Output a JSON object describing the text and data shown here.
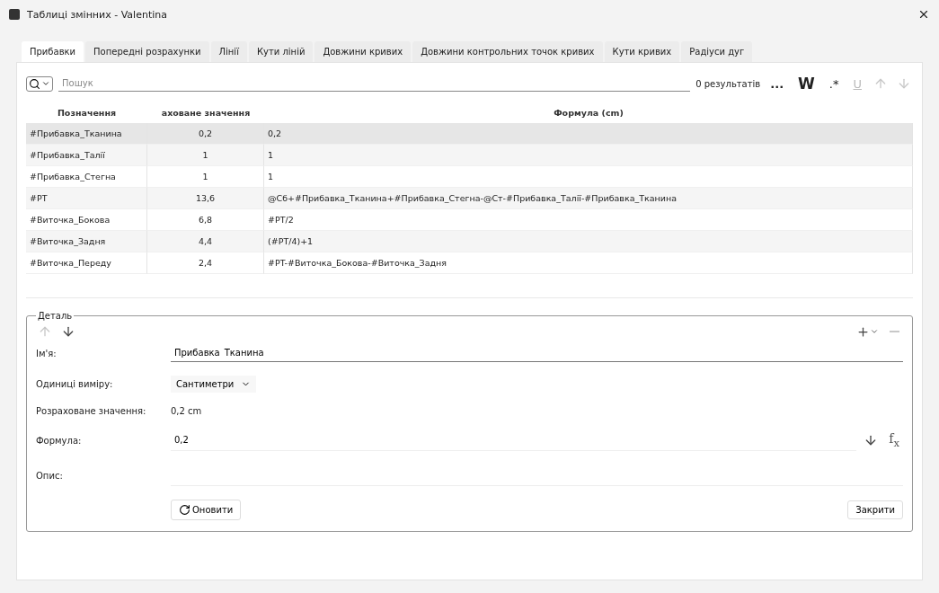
{
  "window": {
    "title": "Таблиці змінних - Valentina"
  },
  "tabs": [
    {
      "label": "Прибавки",
      "selected": true
    },
    {
      "label": "Попередні розрахунки",
      "selected": false
    },
    {
      "label": "Лінії",
      "selected": false
    },
    {
      "label": "Кути ліній",
      "selected": false
    },
    {
      "label": "Довжини кривих",
      "selected": false
    },
    {
      "label": "Довжини контрольних точок кривих",
      "selected": false
    },
    {
      "label": "Кути кривих",
      "selected": false
    },
    {
      "label": "Радіуси дуг",
      "selected": false
    }
  ],
  "search": {
    "placeholder": "Пошук",
    "results": "0 результатів",
    "options": [
      {
        "label": "...",
        "kind": "dots",
        "disabled": false
      },
      {
        "label": "W",
        "kind": "bold",
        "disabled": false
      },
      {
        "label": ".*",
        "kind": "regex",
        "disabled": false
      },
      {
        "label": "U",
        "kind": "underline",
        "disabled": true
      }
    ],
    "nav": [
      {
        "kind": "up",
        "disabled": true
      },
      {
        "kind": "down",
        "disabled": true
      }
    ]
  },
  "table": {
    "columns": [
      "Позначення",
      "аховане значення",
      "Формула (cm)"
    ],
    "rows": [
      {
        "cells": [
          "#Прибавка_Тканина",
          "0,2",
          "0,2"
        ],
        "selected": true
      },
      {
        "cells": [
          "#Прибавка_Талії",
          "1",
          "1"
        ],
        "selected": false
      },
      {
        "cells": [
          "#Прибавка_Стегна",
          "1",
          "1"
        ],
        "selected": false
      },
      {
        "cells": [
          "#PT",
          "13,6",
          "@Сб+#Прибавка_Тканина+#Прибавка_Стегна-@Ст-#Прибавка_Талії-#Прибавка_Тканина"
        ],
        "selected": false
      },
      {
        "cells": [
          "#Виточка_Бокова",
          "6,8",
          "#PT/2"
        ],
        "selected": false
      },
      {
        "cells": [
          "#Виточка_Задня",
          "4,4",
          "(#PT/4)+1"
        ],
        "selected": false
      },
      {
        "cells": [
          "#Виточка_Переду",
          "2,4",
          "#PT-#Виточка_Бокова-#Виточка_Задня"
        ],
        "selected": false
      }
    ]
  },
  "detail": {
    "title": "Деталь",
    "move": [
      {
        "kind": "up",
        "disabled": true
      },
      {
        "kind": "down",
        "disabled": false
      }
    ],
    "remove_disabled": true,
    "name_label": "Ім'я:",
    "name_value": "Прибавка_Тканина",
    "units_label": "Одиниці виміру:",
    "units_value": "Сантиметри",
    "calc_label": "Розраховане значення:",
    "calc_value": "0,2 cm",
    "formula_label": "Формула:",
    "formula_value": "0,2",
    "fx": "f$_{x}$",
    "description_label": "Опис:",
    "refresh": "Оновити",
    "close": "Закрити"
  }
}
